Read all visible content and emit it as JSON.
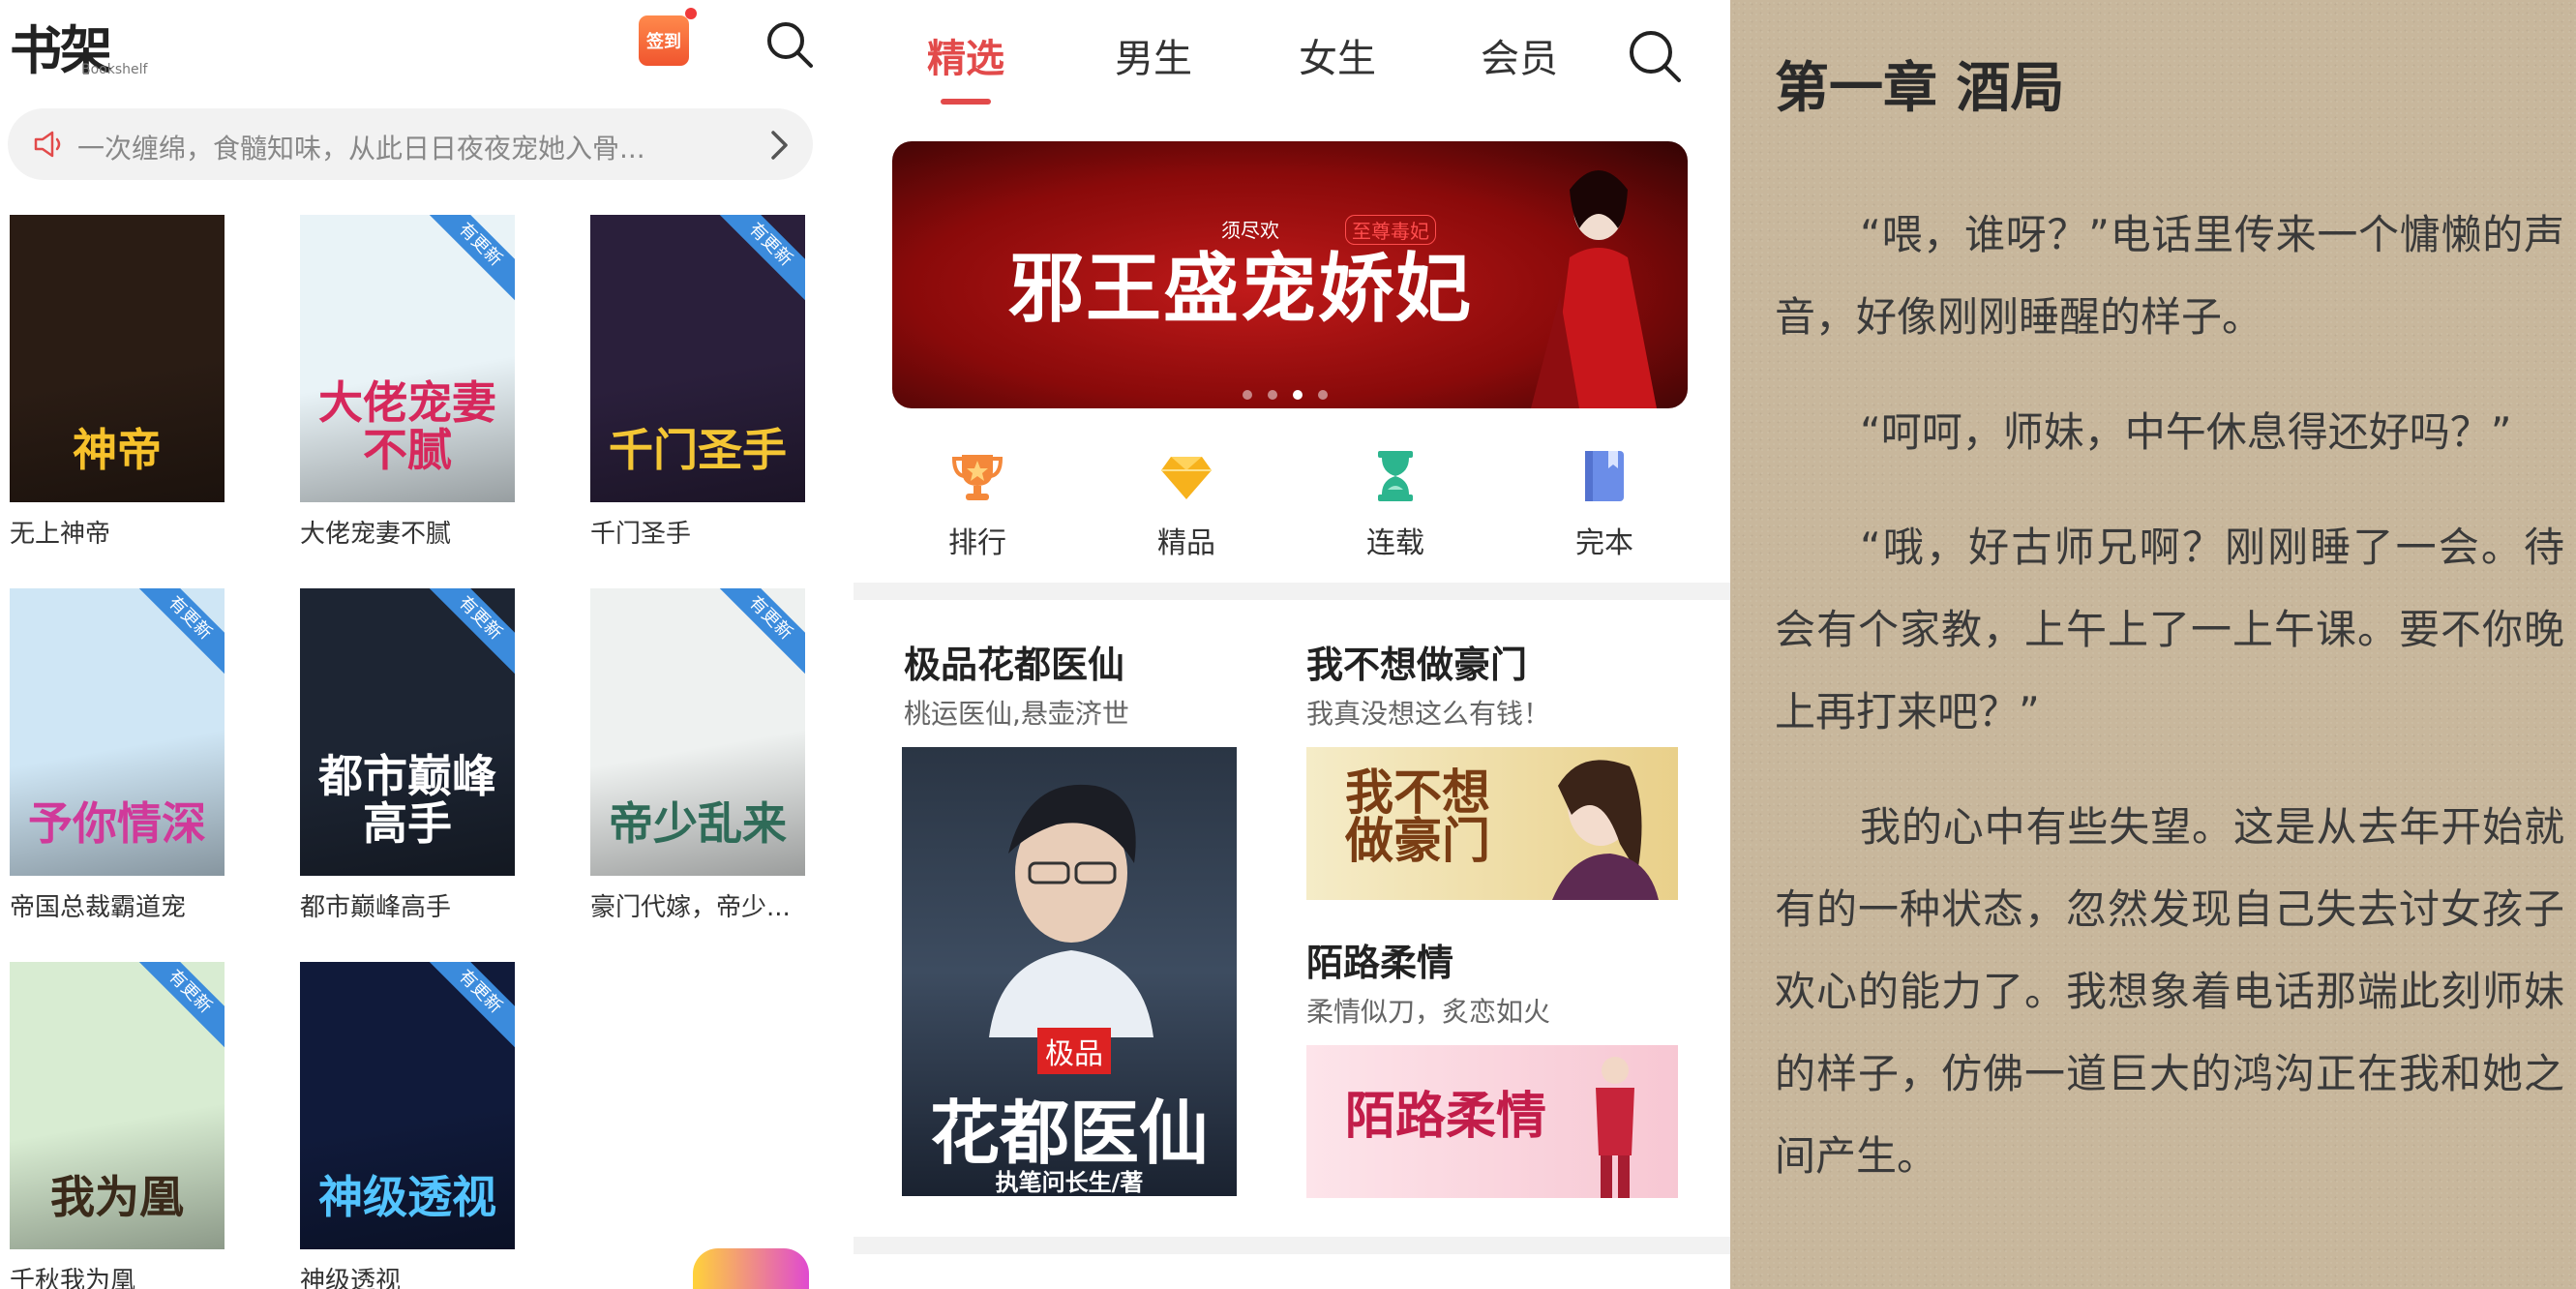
{
  "bookshelf": {
    "logo_cn": "书架",
    "logo_en": "Bookshelf",
    "signin_label": "签到",
    "notice_text": "一次缠绵，食髓知味，从此日日夜夜宠她入骨...",
    "update_badge": "有更新",
    "books": [
      {
        "name": "无上神帝",
        "cover_text": "神帝",
        "updated": false,
        "bg": "#2a1c14",
        "fg": "#f6c12b"
      },
      {
        "name": "大佬宠妻不腻",
        "cover_text": "大佬宠妻不腻",
        "updated": true,
        "bg": "#e9f3f7",
        "fg": "#d6285c"
      },
      {
        "name": "千门圣手",
        "cover_text": "千门圣手",
        "updated": true,
        "bg": "#2a1f3b",
        "fg": "#f4c634"
      },
      {
        "name": "帝国总裁霸道宠",
        "cover_text": "予你情深",
        "updated": true,
        "bg": "#cfe6f5",
        "fg": "#d03a9a"
      },
      {
        "name": "都市巅峰高手",
        "cover_text": "都市巅峰高手",
        "updated": true,
        "bg": "#1d2533",
        "fg": "#ffffff"
      },
      {
        "name": "豪门代嫁，帝少...",
        "cover_text": "帝少乱来",
        "updated": true,
        "bg": "#eef1f0",
        "fg": "#2f6b58"
      },
      {
        "name": "千秋我为凰",
        "cover_text": "我为凰",
        "updated": true,
        "bg": "#d8ecd2",
        "fg": "#3a2a1a"
      },
      {
        "name": "神级透视",
        "cover_text": "神级透视",
        "updated": true,
        "bg": "#101a3a",
        "fg": "#53c4ff"
      }
    ]
  },
  "store": {
    "tabs": [
      "精选",
      "男生",
      "女生",
      "会员"
    ],
    "active_tab": "精选",
    "banner": {
      "title": "邪王盛宠娇妃",
      "author": "须尽欢",
      "tag": "至尊毒妃"
    },
    "categories": [
      {
        "label": "排行",
        "color": "#f4883a"
      },
      {
        "label": "精品",
        "color": "#f7b21c"
      },
      {
        "label": "连载",
        "color": "#2cb58e"
      },
      {
        "label": "完本",
        "color": "#6b8de8"
      }
    ],
    "recs": [
      {
        "title": "极品花都医仙",
        "subtitle": "桃运医仙,悬壶济世",
        "cover_tag": "极品",
        "cover_title": "花都医仙",
        "cover_author": "执笔问长生/著"
      },
      {
        "title": "我不想做豪门",
        "subtitle": "我真没想这么有钱！",
        "cover_title": "我不想做豪门"
      },
      {
        "title": "陌路柔情",
        "subtitle": "柔情似刀，炙恋如火",
        "cover_title": "陌路柔情"
      }
    ]
  },
  "reader": {
    "chapter_title": "第一章 酒局",
    "paragraphs": [
      "“喂，谁呀？”电话里传来一个慵懒的声音，好像刚刚睡醒的样子。",
      "“呵呵，师妹，中午休息得还好吗？”",
      "“哦，好古师兄啊？刚刚睡了一会。待会有个家教，上午上了一上午课。要不你晚上再打来吧？”",
      "我的心中有些失望。这是从去年开始就有的一种状态，忽然发现自己失去讨女孩子欢心的能力了。我想象着电话那端此刻师妹的样子，仿佛一道巨大的鸿沟正在我和她之间产生。"
    ]
  },
  "colors": {
    "accent": "#e24a4a",
    "badge": "#3b8bdc",
    "reader_bg": "#c8b79c"
  }
}
